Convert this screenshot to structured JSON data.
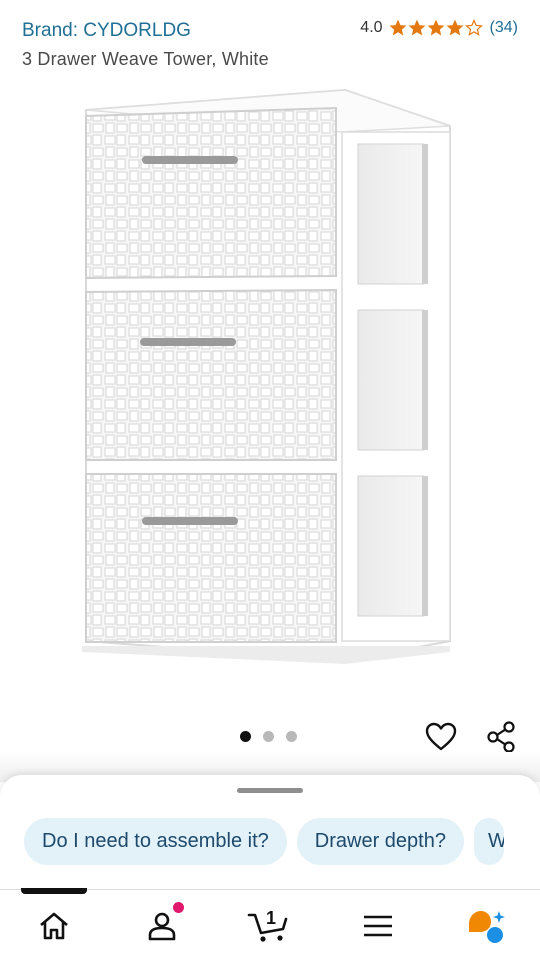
{
  "product": {
    "brand": "Brand: CYDORLDG",
    "title": "3 Drawer Weave Tower, White",
    "rating_value": "4.0",
    "rating_stars": 4,
    "rating_count": "(34)"
  },
  "carousel": {
    "total": 3,
    "active": 1
  },
  "chips": [
    "Do I need to assemble it?",
    "Drawer depth?",
    "W"
  ],
  "nav": {
    "items": [
      "home-icon",
      "account-icon",
      "cart-icon",
      "menu-icon",
      "rufus-icon"
    ],
    "cart_count": "1"
  },
  "colors": {
    "link": "#1f6f96",
    "star": "#e47911",
    "chip_bg": "#e3f1f8",
    "notification": "#e0186e",
    "rufus_orange": "#f08804",
    "rufus_blue": "#1a8fe3"
  }
}
